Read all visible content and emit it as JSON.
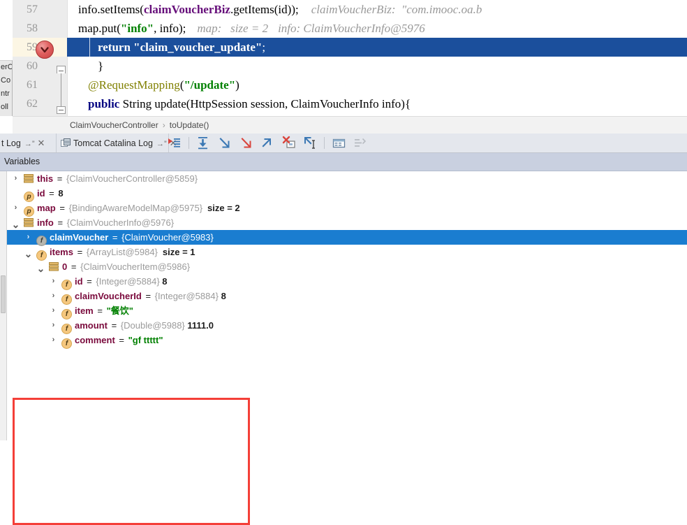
{
  "editor": {
    "left_popup_fragments": [
      "erC",
      "Co",
      "ntr",
      "oll"
    ],
    "lines": [
      {
        "number": "57"
      },
      {
        "number": "58"
      },
      {
        "number": "59"
      },
      {
        "number": "60"
      },
      {
        "number": "61"
      },
      {
        "number": "62"
      }
    ],
    "line57": {
      "text_a": "info.setItems(",
      "field": "claimVoucherBiz",
      "text_b": ".getItems(id));",
      "hint": "claimVoucherBiz:  \"com.imooc.oa.b"
    },
    "line58": {
      "text_a": "map.put(",
      "str": "\"info\"",
      "text_b": ", info);",
      "hint_a": "map:   size = 2",
      "hint_b": "info: ClaimVoucherInfo@5976"
    },
    "line59": {
      "keyword": "return ",
      "str": "\"claim_voucher_update\"",
      "text_b": ";"
    },
    "line60": {
      "text": "}"
    },
    "line61": {
      "anno": "@RequestMapping",
      "paren_open": "(",
      "str": "\"/update\"",
      "paren_close": ")"
    },
    "line62": {
      "kw1": "public ",
      "text_a": "String update(HttpSession session, ClaimVoucherInfo info){"
    },
    "breakpoint_icon": "breakpoint-verified-icon"
  },
  "breadcrumb": {
    "class_name": "ClaimVoucherController",
    "separator": "›",
    "method_name": "toUpdate()"
  },
  "tabs": [
    {
      "label": "t Log",
      "pin": "→”",
      "close": "✕",
      "icon": ""
    },
    {
      "label": "Tomcat Catalina Log",
      "pin": "→”",
      "close": "✕",
      "icon": "tomcat-log-icon"
    }
  ],
  "toolbar": {
    "buttons": [
      {
        "name": "show-execution-point-icon",
        "title": "Show Execution Point"
      },
      {
        "name": "step-over-icon",
        "title": "Step Over"
      },
      {
        "name": "step-into-icon",
        "title": "Step Into"
      },
      {
        "name": "force-step-into-icon",
        "title": "Force Step Into"
      },
      {
        "name": "step-out-icon",
        "title": "Step Out"
      },
      {
        "name": "drop-frame-icon",
        "title": "Drop Frame"
      },
      {
        "name": "run-to-cursor-icon",
        "title": "Run to Cursor"
      },
      {
        "name": "evaluate-expression-icon",
        "title": "Evaluate Expression"
      },
      {
        "name": "watches-icon",
        "title": "Watches"
      }
    ]
  },
  "variables_panel": {
    "title": "Variables",
    "rows": [
      {
        "indent": 0,
        "arrow": "›",
        "icon": "object-icon",
        "badge": "",
        "name": "this",
        "eq": "=",
        "ref": "{ClaimVoucherController@5859}",
        "value": "",
        "value_kind": "none",
        "size": "",
        "selected": false
      },
      {
        "indent": 0,
        "arrow": "",
        "icon": "",
        "badge": "p",
        "name": "id",
        "eq": "=",
        "ref": "",
        "value": "8",
        "value_kind": "number",
        "size": "",
        "selected": false
      },
      {
        "indent": 0,
        "arrow": "›",
        "icon": "",
        "badge": "p",
        "name": "map",
        "eq": "=",
        "ref": "{BindingAwareModelMap@5975}",
        "value": "",
        "value_kind": "none",
        "size": "size = 2",
        "selected": false
      },
      {
        "indent": 0,
        "arrow": "⌄",
        "icon": "object-icon",
        "badge": "",
        "name": "info",
        "eq": "=",
        "ref": "{ClaimVoucherInfo@5976}",
        "value": "",
        "value_kind": "none",
        "size": "",
        "selected": false
      },
      {
        "indent": 1,
        "arrow": "›",
        "icon": "",
        "badge": "f-gray",
        "name": "claimVoucher",
        "eq": "=",
        "ref": "{ClaimVoucher@5983}",
        "value": "",
        "value_kind": "none",
        "size": "",
        "selected": true
      },
      {
        "indent": 1,
        "arrow": "⌄",
        "icon": "",
        "badge": "f",
        "name": "items",
        "eq": "=",
        "ref": "{ArrayList@5984}",
        "value": "",
        "value_kind": "none",
        "size": "size = 1",
        "selected": false
      },
      {
        "indent": 2,
        "arrow": "⌄",
        "icon": "object-icon",
        "badge": "",
        "name": "0",
        "eq": "=",
        "ref": "{ClaimVoucherItem@5986}",
        "value": "",
        "value_kind": "none",
        "size": "",
        "selected": false
      },
      {
        "indent": 3,
        "arrow": "›",
        "icon": "",
        "badge": "f",
        "name": "id",
        "eq": "=",
        "ref": "{Integer@5884}",
        "value": "8",
        "value_kind": "number",
        "size": "",
        "selected": false
      },
      {
        "indent": 3,
        "arrow": "›",
        "icon": "",
        "badge": "f",
        "name": "claimVoucherId",
        "eq": "=",
        "ref": "{Integer@5884}",
        "value": "8",
        "value_kind": "number",
        "size": "",
        "selected": false
      },
      {
        "indent": 3,
        "arrow": "›",
        "icon": "",
        "badge": "f",
        "name": "item",
        "eq": "=",
        "ref": "",
        "value": "\"餐饮\"",
        "value_kind": "string",
        "size": "",
        "selected": false
      },
      {
        "indent": 3,
        "arrow": "›",
        "icon": "",
        "badge": "f",
        "name": "amount",
        "eq": "=",
        "ref": "{Double@5988}",
        "value": "1111.0",
        "value_kind": "number",
        "size": "",
        "selected": false
      },
      {
        "indent": 3,
        "arrow": "›",
        "icon": "",
        "badge": "f",
        "name": "comment",
        "eq": "=",
        "ref": "",
        "value": "\"gf ttttt\"",
        "value_kind": "string",
        "size": "",
        "selected": false
      }
    ]
  },
  "annotation": {
    "highlight_box_color": "#f43f38",
    "selection_color": "#1a7dd0",
    "execution_line_color": "#1b4f9c"
  }
}
